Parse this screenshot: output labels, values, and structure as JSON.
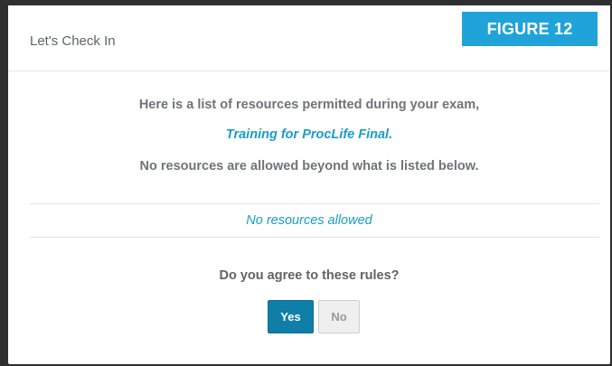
{
  "modal": {
    "title": "Let's Check In",
    "badge": "FIGURE 12"
  },
  "body": {
    "line1": "Here is a list of resources permitted during your exam,",
    "exam_name": "Training for ProcLife Final.",
    "line3": "No resources are allowed beyond what is listed below.",
    "resources_text": "No resources allowed",
    "question": "Do you agree to these rules?"
  },
  "buttons": {
    "yes_label": "Yes",
    "no_label": "No"
  },
  "colors": {
    "accent": "#1a9cc9",
    "primary_button": "#0f7fa9",
    "badge": "#1fa3d9"
  }
}
